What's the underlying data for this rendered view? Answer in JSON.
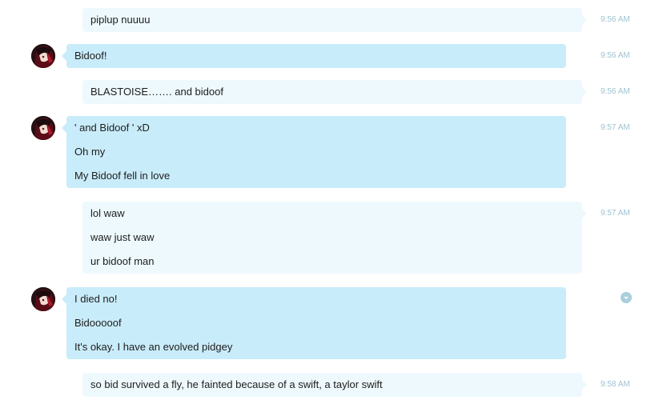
{
  "messages": [
    {
      "sender": "me",
      "lines": [
        "piplup nuuuu"
      ],
      "time": "9:56 AM"
    },
    {
      "sender": "them",
      "lines": [
        "Bidoof!"
      ],
      "time": "9:56 AM"
    },
    {
      "sender": "me",
      "lines": [
        "BLASTOISE……. and bidoof"
      ],
      "time": "9:56 AM"
    },
    {
      "sender": "them",
      "lines": [
        "' and Bidoof ' xD",
        "Oh my",
        "My Bidoof fell in love"
      ],
      "time": "9:57 AM"
    },
    {
      "sender": "me",
      "lines": [
        "lol waw",
        "waw just waw",
        "ur bidoof man"
      ],
      "time": "9:57 AM"
    },
    {
      "sender": "them",
      "lines": [
        "I died no!",
        "Bidooooof",
        "It's okay. I have an evolved pidgey"
      ],
      "time": ""
    },
    {
      "sender": "me",
      "lines": [
        "so bid survived a fly, he fainted because of a swift, a taylor swift"
      ],
      "time": "9:58 AM"
    }
  ],
  "icons": {
    "avatar": "user-avatar",
    "message_menu": "chevron-down-circle-icon"
  },
  "colors": {
    "their_bubble": "#c9ecfa",
    "my_bubble": "#eef9fe",
    "timestamp": "#9fc3d2",
    "menu_icon": "#a9cfdc"
  }
}
